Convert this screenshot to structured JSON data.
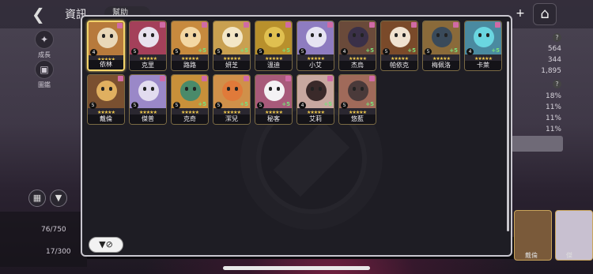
{
  "header": {
    "title": "資訊",
    "help_label": "幫助",
    "back_icon": "back-arrow-icon",
    "home_icon": "home-icon",
    "plus_icon": "plus-icon"
  },
  "sidebar": {
    "items": [
      {
        "label": "成長",
        "icon": "growth-icon"
      },
      {
        "label": "圖鑑",
        "icon": "codex-icon"
      }
    ]
  },
  "stats": {
    "values": [
      "564",
      "344",
      "1,895",
      "18%",
      "11%",
      "11%",
      "11%"
    ]
  },
  "counters": {
    "top": "76/750",
    "bottom": "17/300"
  },
  "behind_labels": [
    "戴倫",
    "傑"
  ],
  "popup": {
    "filter_icon": "filter-icon",
    "characters": [
      {
        "name": "依林",
        "level": "4",
        "plus": "",
        "stars": 5,
        "selected": true,
        "color": "#e9d8b8",
        "bg": "#b77a3c"
      },
      {
        "name": "克里",
        "level": "5",
        "plus": "",
        "stars": 5,
        "selected": false,
        "color": "#e8e2ee",
        "bg": "#a4405a"
      },
      {
        "name": "路路",
        "level": "5",
        "plus": "+5",
        "stars": 5,
        "selected": false,
        "color": "#f3d7a3",
        "bg": "#c78a3e"
      },
      {
        "name": "妍芝",
        "level": "5",
        "plus": "+5",
        "stars": 5,
        "selected": false,
        "color": "#f3e6c6",
        "bg": "#c9a050"
      },
      {
        "name": "溫迪",
        "level": "5",
        "plus": "+5",
        "stars": 5,
        "selected": false,
        "color": "#e0c050",
        "bg": "#b8902c"
      },
      {
        "name": "小艾",
        "level": "5",
        "plus": "",
        "stars": 5,
        "selected": false,
        "color": "#e6e4f2",
        "bg": "#8e7cc0"
      },
      {
        "name": "杰烏",
        "level": "4",
        "plus": "+5",
        "stars": 5,
        "selected": false,
        "color": "#3a3048",
        "bg": "#6a4a3a"
      },
      {
        "name": "帕依克",
        "level": "5",
        "plus": "+5",
        "stars": 5,
        "selected": false,
        "color": "#f0e2d0",
        "bg": "#7a4a2a"
      },
      {
        "name": "梅佩洛",
        "level": "5",
        "plus": "+5",
        "stars": 5,
        "selected": false,
        "color": "#3a4a5a",
        "bg": "#8a6a3a"
      },
      {
        "name": "卡萊",
        "level": "4",
        "plus": "+5",
        "stars": 5,
        "selected": false,
        "color": "#6ad6e0",
        "bg": "#4a8aa0"
      },
      {
        "name": "戴倫",
        "level": "5",
        "plus": "",
        "stars": 5,
        "selected": false,
        "color": "#e0b060",
        "bg": "#7a5030"
      },
      {
        "name": "傑普",
        "level": "5",
        "plus": "",
        "stars": 5,
        "selected": false,
        "color": "#e2dcef",
        "bg": "#9a88c8"
      },
      {
        "name": "克奇",
        "level": "5",
        "plus": "+5",
        "stars": 5,
        "selected": false,
        "color": "#4a8a6a",
        "bg": "#c8903a"
      },
      {
        "name": "潔兒",
        "level": "5",
        "plus": "+5",
        "stars": 5,
        "selected": false,
        "color": "#e07a3a",
        "bg": "#d0904a"
      },
      {
        "name": "秘客",
        "level": "5",
        "plus": "+5",
        "stars": 5,
        "selected": false,
        "color": "#f4f2f4",
        "bg": "#a85a7a"
      },
      {
        "name": "艾莉",
        "level": "4",
        "plus": "+5",
        "stars": 5,
        "selected": false,
        "color": "#3a2a2a",
        "bg": "#c8a8a0"
      },
      {
        "name": "悠藍",
        "level": "5",
        "plus": "+5",
        "stars": 5,
        "selected": false,
        "color": "#4a3a3a",
        "bg": "#a06a5a"
      }
    ]
  }
}
